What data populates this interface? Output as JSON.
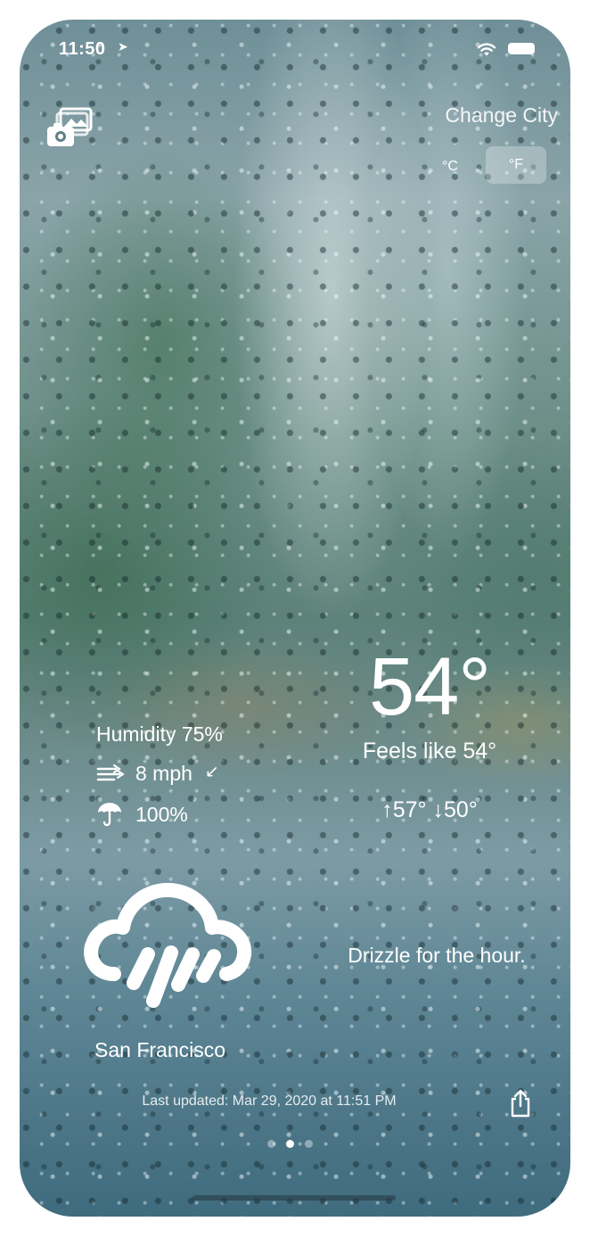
{
  "status_bar": {
    "time": "11:50",
    "location_arrow": "➤"
  },
  "header": {
    "camera_icon": "camera-photos-icon",
    "change_city": "Change City",
    "units": {
      "celsius": "°C",
      "fahrenheit": "°F",
      "selected": "°F"
    }
  },
  "weather": {
    "temperature": "54°",
    "feels_like": "Feels like 54°",
    "hi_lo": "↑57° ↓50°",
    "humidity": "Humidity 75%",
    "wind_speed": "8 mph",
    "wind_direction": "↙",
    "precipitation": "100%",
    "summary": "Drizzle for the hour.",
    "condition_icon": "cloud-rain-icon"
  },
  "location": {
    "city": "San Francisco",
    "last_updated": "Last updated: Mar 29, 2020 at 11:51 PM"
  },
  "pager": {
    "count": 3,
    "active_index": 1
  },
  "colors": {
    "text": "#ffffff",
    "unit_selected_bg": "rgba(255,255,255,0.28)"
  }
}
